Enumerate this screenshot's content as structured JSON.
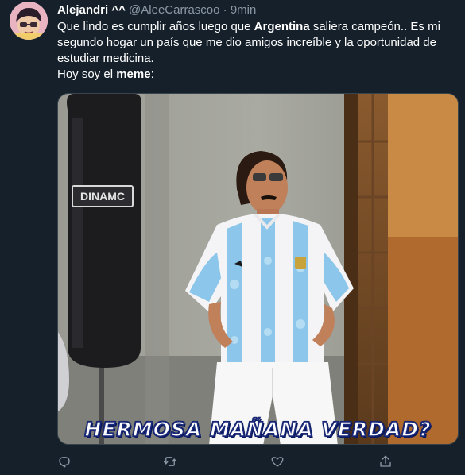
{
  "tweet": {
    "author_name": "Alejandri ^^",
    "handle": "@AleeCarrascoo",
    "separator": "·",
    "time": "9min",
    "text": {
      "part1": "Que lindo es cumplir años luego que ",
      "bold1": "Argentina",
      "part2": " saliera campeón.. Es mi segundo hogar un país que me dio amigos increíble y la oportunidad de estudiar medicina.",
      "line2": "Hoy soy el ",
      "bold2": "meme",
      "line2_end": ":"
    },
    "media": {
      "caption": "HERMOSA MAÑANA VERDAD?",
      "bag_label": "DINAMC"
    }
  },
  "actions": [
    {
      "name": "reply",
      "icon": "reply-icon"
    },
    {
      "name": "retweet",
      "icon": "retweet-icon"
    },
    {
      "name": "like",
      "icon": "like-icon"
    },
    {
      "name": "share",
      "icon": "share-icon"
    }
  ],
  "colors": {
    "background": "#15202b",
    "secondary_text": "#8b98a5",
    "border": "#38444d"
  }
}
